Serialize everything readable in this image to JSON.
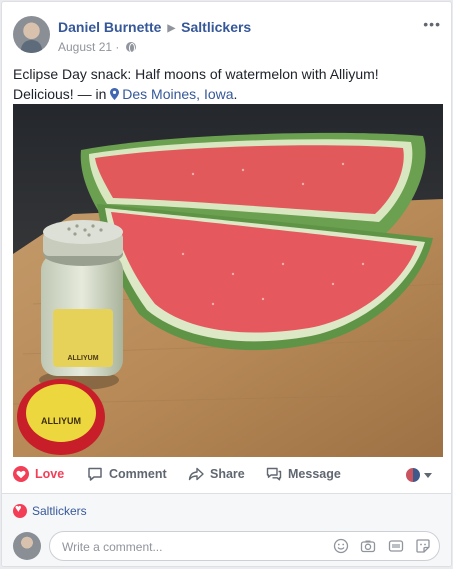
{
  "post": {
    "author": "Daniel Burnette",
    "group": "Saltlickers",
    "date": "August 21 · ",
    "text": "Eclipse Day snack: Half moons of watermelon with Alliyum! Delicious! — in ",
    "location": "Des Moines, Iowa",
    "location_suffix": ".",
    "more_label": "•••",
    "photo_labels": {
      "shaker_label": "ALLIYUM",
      "lid_label": "ALLIYUM"
    }
  },
  "actions": {
    "love": "Love",
    "comment": "Comment",
    "share": "Share",
    "message": "Message"
  },
  "reactions": {
    "names": "Saltlickers"
  },
  "comment_input": {
    "placeholder": "Write a comment..."
  },
  "colors": {
    "link": "#365899",
    "love": "#f33e58",
    "muted": "#90949c"
  },
  "icons": [
    "globe-icon",
    "location-pin-icon",
    "heart-icon",
    "comment-icon",
    "share-icon",
    "message-icon",
    "emoji-icon",
    "camera-icon",
    "gif-icon",
    "sticker-icon"
  ]
}
